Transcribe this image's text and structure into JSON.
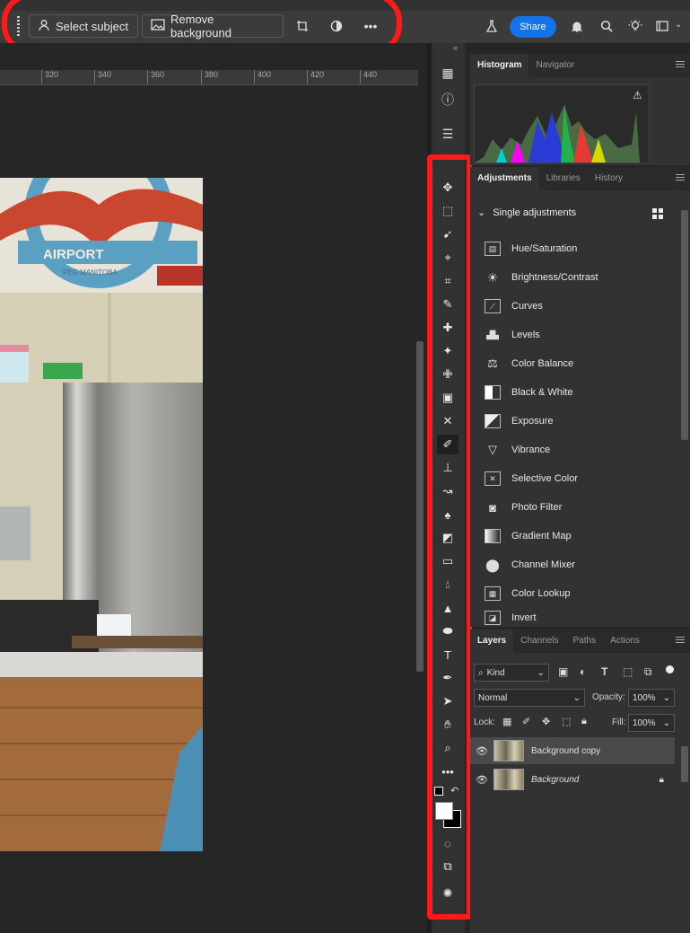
{
  "options_bar": {
    "select_subject": "Select subject",
    "remove_background": "Remove background",
    "share": "Share"
  },
  "ruler": {
    "ticks": [
      "320",
      "340",
      "360",
      "380",
      "400",
      "420",
      "440"
    ]
  },
  "panels": {
    "top_tabs": [
      "Histogram",
      "Navigator"
    ],
    "adj_tabs": [
      "Adjustments",
      "Libraries",
      "History"
    ],
    "single_adjustments": "Single adjustments",
    "adjustments": [
      "Hue/Saturation",
      "Brightness/Contrast",
      "Curves",
      "Levels",
      "Color Balance",
      "Black & White",
      "Exposure",
      "Vibrance",
      "Selective Color",
      "Photo Filter",
      "Gradient Map",
      "Channel Mixer",
      "Color Lookup",
      "Invert"
    ],
    "layer_tabs": [
      "Layers",
      "Channels",
      "Paths",
      "Actions"
    ],
    "filter_kind": "Kind",
    "blend_mode": "Normal",
    "opacity_label": "Opacity:",
    "opacity_value": "100%",
    "lock_label": "Lock:",
    "fill_label": "Fill:",
    "fill_value": "100%",
    "layers": [
      "Background copy",
      "Background"
    ]
  },
  "photo_text": {
    "sign": "AIRPORT",
    "sign_sub": "PEG MANITOBA"
  },
  "icons": [
    "grip-icon",
    "person-icon",
    "image-icon",
    "crop-perspective-icon",
    "contrast-icon",
    "more-icon",
    "flask-icon",
    "bell-icon",
    "search-icon",
    "lightbulb-icon",
    "workspace-icon"
  ]
}
